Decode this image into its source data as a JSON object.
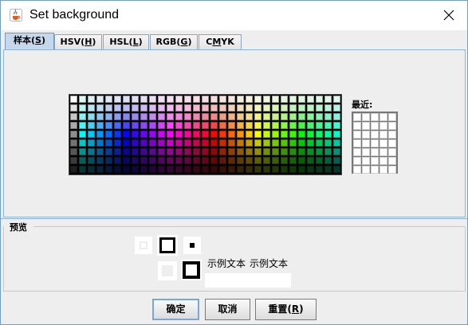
{
  "window": {
    "title": "Set background"
  },
  "tabs": [
    {
      "label_main": "样本(",
      "mnemonic": "S",
      "label_end": ")",
      "active": true
    },
    {
      "label_main": "HSV(",
      "mnemonic": "H",
      "label_end": ")",
      "active": false
    },
    {
      "label_main": "HSL(",
      "mnemonic": "L",
      "label_end": ")",
      "active": false
    },
    {
      "label_main": "RGB(",
      "mnemonic": "G",
      "label_end": ")",
      "active": false
    },
    {
      "label_main": "C",
      "mnemonic": "M",
      "label_end": "YK",
      "active": false
    }
  ],
  "swatches": {
    "recent_label": "最近:"
  },
  "preview": {
    "legend": "预览",
    "sample_text_1": "示例文本",
    "sample_text_2": "示例文本"
  },
  "buttons": {
    "ok": "确定",
    "cancel": "取消",
    "reset_main": "重置(",
    "reset_mnemonic": "R",
    "reset_end": ")"
  },
  "colors": {
    "tab_active": "#c5d7ea",
    "panel_border": "#8fb4d9",
    "dialog_bg": "#eeeeee"
  }
}
